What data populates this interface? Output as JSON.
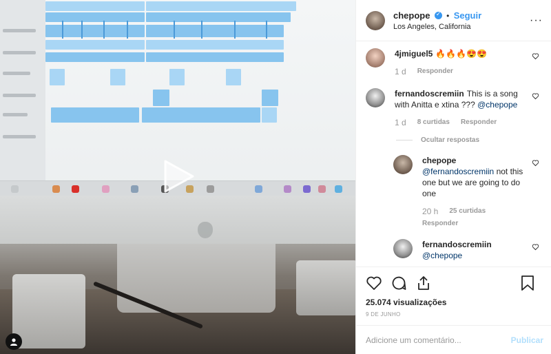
{
  "header": {
    "username": "chepope",
    "separator": "•",
    "follow_label": "Seguir",
    "location": "Los Angeles, California",
    "more_icon": "more-options-icon",
    "more_glyph": "···"
  },
  "comments": [
    {
      "username": "4jmiguel5",
      "text": "🔥🔥🔥😍😍",
      "time": "1 d",
      "likes": "",
      "reply_label": "Responder"
    },
    {
      "username": "fernandoscremiin",
      "text": "This is a song with Anitta e xtina ???",
      "mention": "@chepope",
      "time": "1 d",
      "likes": "8 curtidas",
      "reply_label": "Responder"
    }
  ],
  "hide_replies_label": "Ocultar respostas",
  "replies": [
    {
      "username": "chepope",
      "mention": "@fernandoscremiin",
      "text": "not this one but we are going to do one",
      "time": "20 h",
      "likes": "25 curtidas",
      "reply_label": "Responder"
    },
    {
      "username": "fernandoscremiin",
      "mention": "@chepope",
      "text": ""
    }
  ],
  "actions": {
    "views": "25.074 visualizações",
    "date": "9 DE JUNHO"
  },
  "add_comment": {
    "placeholder": "Adicione um comentário...",
    "post_label": "Publicar"
  }
}
